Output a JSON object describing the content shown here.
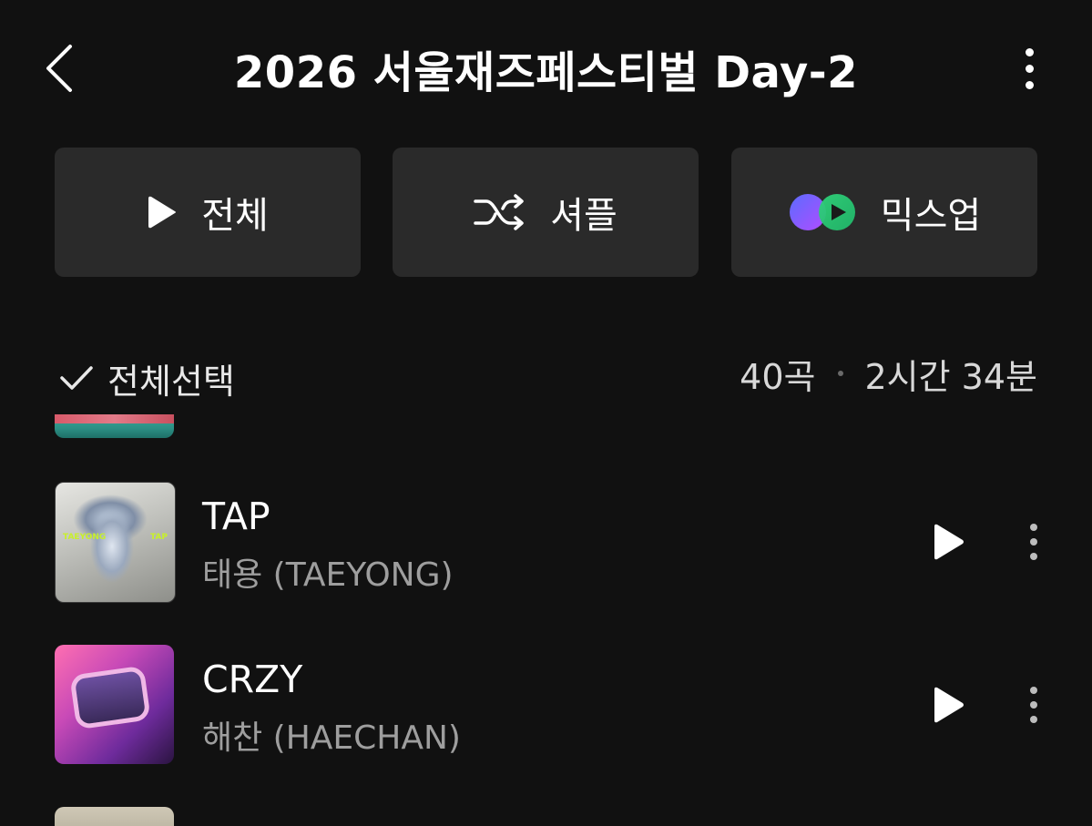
{
  "header": {
    "title": "2026 서울재즈페스티벌 Day-2",
    "back_icon": "chevron-left-icon",
    "more_icon": "more-vertical-icon"
  },
  "actions": {
    "play_all_label": "전체",
    "shuffle_label": "셔플",
    "mixup_label": "믹스업"
  },
  "list_header": {
    "select_all_label": "전체선택",
    "track_count": "40곡",
    "duration": "2시간 34분"
  },
  "songs": [
    {
      "title": "TAP",
      "artist": "태용 (TAEYONG)",
      "cover_text_left": "TAEYONG",
      "cover_text_right": "TAP"
    },
    {
      "title": "CRZY",
      "artist": "해찬 (HAECHAN)"
    }
  ],
  "colors": {
    "background": "#111111",
    "button_bg": "#2a2a2a",
    "text_primary": "#ffffff",
    "text_secondary": "#9e9e9e",
    "mixup_purple": "#7b5cff",
    "mixup_green": "#33d17a"
  }
}
